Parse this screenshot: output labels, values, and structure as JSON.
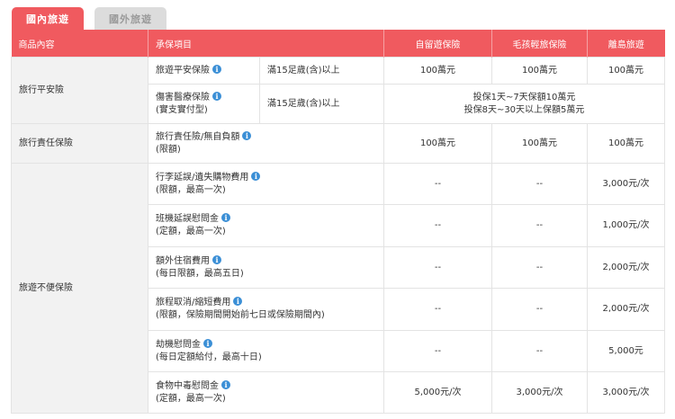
{
  "tabs": {
    "domestic": "國內旅遊",
    "overseas": "國外旅遊"
  },
  "header": {
    "product": "商品內容",
    "coverage": "承保項目",
    "plan1": "自留遊保險",
    "plan2": "毛孩輕旅保險",
    "plan3": "離島旅遊"
  },
  "rows": [
    {
      "category": "旅行平安險",
      "item": "旅遊平安保險",
      "note": "",
      "condition": "滿15足歲(含)以上",
      "v1": "100萬元",
      "v2": "100萬元",
      "v3": "100萬元"
    },
    {
      "item": "傷害醫療保險",
      "note": "(實支實付型)",
      "condition": "滿15足歲(含)以上",
      "merged_line1": "投保1天~7天保額10萬元",
      "merged_line2": "投保8天~30天以上保額5萬元"
    },
    {
      "category": "旅行責任保險",
      "item": "旅行責任險/無自負額",
      "note": "(限額)",
      "v1": "100萬元",
      "v2": "100萬元",
      "v3": "100萬元"
    },
    {
      "category": "旅遊不便保險",
      "item": "行李延誤/遺失購物費用",
      "note": "(限額，最高一次)",
      "v1": "--",
      "v2": "--",
      "v3": "3,000元/次"
    },
    {
      "item": "班機延誤慰問金",
      "note": "(定額，最高一次)",
      "v1": "--",
      "v2": "--",
      "v3": "1,000元/次"
    },
    {
      "item": "額外住宿費用",
      "note": "(每日限額，最高五日)",
      "v1": "--",
      "v2": "--",
      "v3": "2,000元/次"
    },
    {
      "item": "旅程取消/縮短費用",
      "note": "(限額，保險期間開始前七日或保險期間內)",
      "v1": "--",
      "v2": "--",
      "v3": "2,000元/次"
    },
    {
      "item": "劫機慰問金",
      "note": "(每日定額給付，最高十日)",
      "v1": "--",
      "v2": "--",
      "v3": "5,000元"
    },
    {
      "item": "食物中毒慰問金",
      "note": "(定額，最高一次)",
      "v1": "5,000元/次",
      "v2": "3,000元/次",
      "v3": "3,000元/次"
    }
  ],
  "icons": {
    "info": "info-icon"
  },
  "colors": {
    "header": "#f05a5f",
    "info": "#3b8fd6",
    "category_bg": "#f2f2f2"
  }
}
